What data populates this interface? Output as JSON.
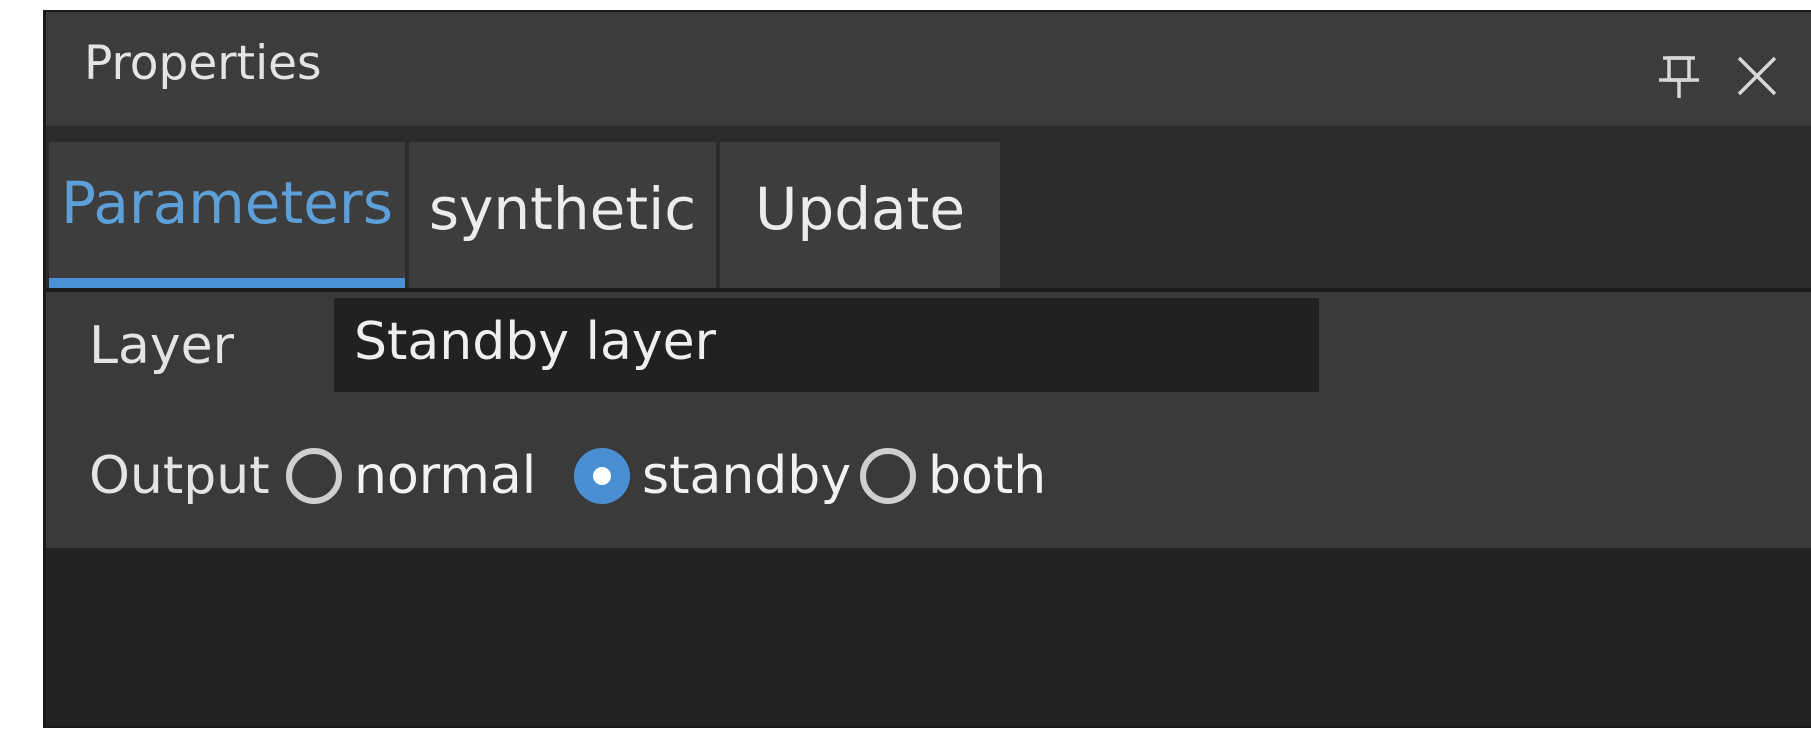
{
  "window": {
    "title": "Properties",
    "icons": [
      "pin-icon",
      "close-icon"
    ]
  },
  "tabs": [
    {
      "label": "Parameters",
      "active": true
    },
    {
      "label": "synthetic",
      "active": false
    },
    {
      "label": "Update",
      "active": false
    }
  ],
  "fields": {
    "layer_label": "Layer",
    "layer_value": "Standby layer",
    "output_label": "Output"
  },
  "output_options": [
    {
      "label": "normal",
      "checked": false
    },
    {
      "label": "standby",
      "checked": true
    },
    {
      "label": "both",
      "checked": false
    }
  ],
  "colors": {
    "accent": "#4b91d6",
    "background": "#2b2b2b",
    "titlebar": "#3c3c3c"
  }
}
